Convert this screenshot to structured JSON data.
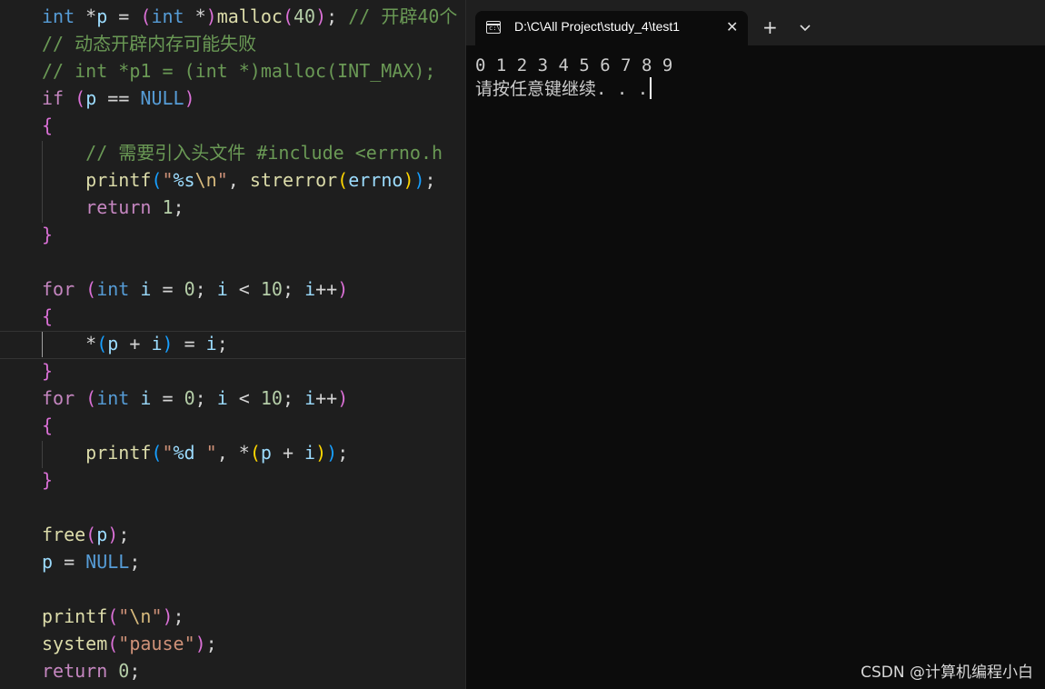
{
  "terminal": {
    "tab_title": "D:\\C\\All Project\\study_4\\test1",
    "close_glyph": "✕",
    "new_tab_glyph": "+",
    "output_line_1": "0 1 2 3 4 5 6 7 8 9",
    "output_line_2": "请按任意键继续. . ."
  },
  "watermark": "CSDN @计算机编程小白",
  "editor": {
    "tokens": {
      "int": "int",
      "star": "*",
      "p": "p",
      "eq": " = ",
      "lp": "(",
      "rp": ")",
      "malloc": "malloc",
      "forty": "40",
      "semi": ";",
      "cmt_open40": " // 开辟40个",
      "cmt_fail": "// 动态开辟内存可能失败",
      "cmt_p1": "// int *p1 = (int *)malloc(INT_MAX);",
      "if": "if",
      "eqeq": " == ",
      "NULL": "NULL",
      "lbrace": "{",
      "rbrace": "}",
      "cmt_include": "// 需要引入头文件 #include <errno.h",
      "printf": "printf",
      "quote": "\"",
      "fmt_s": "%s",
      "esc_n": "\\n",
      "comma": ", ",
      "strerror": "strerror",
      "errno": "errno",
      "return": "return",
      "one": "1",
      "zero": "0",
      "for": "for",
      "i": "i",
      "lt": " < ",
      "ten": "10",
      "inc": "++",
      "plus": " + ",
      "fmt_d": "%d ",
      "free": "free",
      "system": "system",
      "pause": "pause"
    }
  }
}
